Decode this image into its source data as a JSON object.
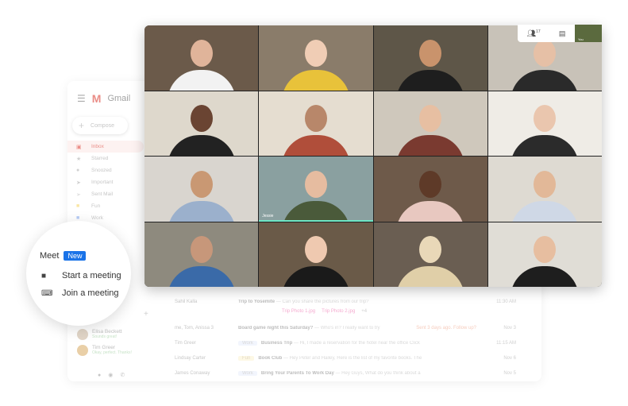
{
  "gmail": {
    "menu_icon": "hamburger-icon",
    "title": "Gmail",
    "compose": "Compose",
    "nav": [
      {
        "label": "Inbox",
        "icon": "inbox-icon",
        "active": true
      },
      {
        "label": "Starred",
        "icon": "star-icon"
      },
      {
        "label": "Snoozed",
        "icon": "clock-icon"
      },
      {
        "label": "Important",
        "icon": "important-icon"
      },
      {
        "label": "Sent Mail",
        "icon": "send-icon"
      },
      {
        "label": "Fun",
        "icon": "label-icon"
      },
      {
        "label": "Work",
        "icon": "label-icon"
      }
    ],
    "chats": [
      {
        "name": "Elisa Beckett",
        "status": "Sounds great!"
      },
      {
        "name": "Tim Greer",
        "status": "Okay, perfect. Thanks!"
      }
    ],
    "emails": [
      {
        "from": "Sahil Kalla",
        "subject": "Trip to Yosemite",
        "snippet": " — Can you share the pictures from our trip?",
        "time": "11:30 AM",
        "attachments": [
          "Trip Photo 1.jpg",
          "Trip Photo 2.jpg",
          "+4"
        ]
      },
      {
        "from": "me, Tom, Anissa 3",
        "subject": "Board game night this Saturday?",
        "snippet": " — Who's in? I really want to try",
        "extra": "Sent 3 days ago. Follow up?",
        "time": "Nov 3"
      },
      {
        "from": "Tim Greer",
        "label": "Work",
        "subject": "Business Trip",
        "snippet": " — Hi, I made a reservation for the hotel near the office Click",
        "time": "11:15 AM"
      },
      {
        "from": "Lindsay Carter",
        "label": "Fun",
        "subject": "Book Club",
        "snippet": " — Hey Peter and Hailey, Here is the list of my favorite books. The",
        "time": "Nov 6"
      },
      {
        "from": "James Conaway",
        "label": "Work",
        "subject": "Bring Your Parents To Work Day",
        "snippet": " — Hey Guys, What do you think about a",
        "time": "Nov 5"
      }
    ]
  },
  "meet": {
    "title": "Meet",
    "badge": "New",
    "items": [
      {
        "label": "Start a meeting",
        "icon": "video-camera-icon"
      },
      {
        "label": "Join a meeting",
        "icon": "keyboard-icon"
      }
    ]
  },
  "call": {
    "participants_count": "17",
    "self_name": "You",
    "speaker_name": "Jessie",
    "tiles": [
      {
        "bg": "#6b5a4a",
        "skin": "#e0b49a",
        "shirt": "#f2f2f2"
      },
      {
        "bg": "#8a7c6a",
        "skin": "#f0cdb5",
        "shirt": "#e8c23a"
      },
      {
        "bg": "#5e5648",
        "skin": "#c9936c",
        "shirt": "#1e1e1e"
      },
      {
        "bg": "#c8c2b8",
        "skin": "#e6c0a6",
        "shirt": "#2a2a2a"
      },
      {
        "bg": "#ded8cc",
        "skin": "#6a4432",
        "shirt": "#222"
      },
      {
        "bg": "#e5ddd0",
        "skin": "#b8876a",
        "shirt": "#b04e3a"
      },
      {
        "bg": "#cfc8bc",
        "skin": "#e7bfa2",
        "shirt": "#7a3a30"
      },
      {
        "bg": "#efece6",
        "skin": "#eac6ae",
        "shirt": "#2b2b2b"
      },
      {
        "bg": "#d9d5cf",
        "skin": "#c99873",
        "shirt": "#9bb0cc"
      },
      {
        "bg": "#8aa0a0",
        "skin": "#e6bca0",
        "shirt": "#4a5a3a",
        "speaking": true
      },
      {
        "bg": "#6e5a4a",
        "skin": "#5e3a28",
        "shirt": "#e8c8c0"
      },
      {
        "bg": "#dedad2",
        "skin": "#e2b898",
        "shirt": "#cfd8e6"
      },
      {
        "bg": "#8e8a7e",
        "skin": "#c7977a",
        "shirt": "#3a6aa8"
      },
      {
        "bg": "#6a5a48",
        "skin": "#efc9b0",
        "shirt": "#1a1a1a"
      },
      {
        "bg": "#6a5e52",
        "skin": "#e9d8b8",
        "shirt": "#e0cfa8"
      },
      {
        "bg": "#e0ddd6",
        "skin": "#e7bea0",
        "shirt": "#1e1e1e"
      }
    ]
  }
}
